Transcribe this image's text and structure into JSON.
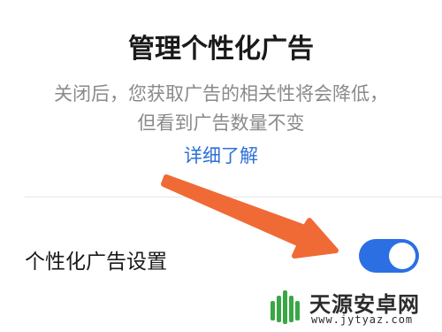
{
  "dialog": {
    "title": "管理个性化广告",
    "description": "关闭后，您获取广告的相关性将会降低，但看到广告数量不变",
    "learn_more": "详细了解"
  },
  "setting": {
    "label": "个性化广告设置",
    "toggle_state": "on",
    "toggle_color": "#2b6fe3"
  },
  "annotation": {
    "arrow_color": "#f06a35",
    "arrow_icon": "arrow-pointer-icon"
  },
  "watermark": {
    "site_name": "天源安卓网",
    "url": "www.jytyaz.com",
    "logo_color": "#3aa745"
  },
  "colors": {
    "link": "#2e6fd8",
    "text_secondary": "#8a8a8a",
    "text_primary": "#1a1a1a"
  }
}
